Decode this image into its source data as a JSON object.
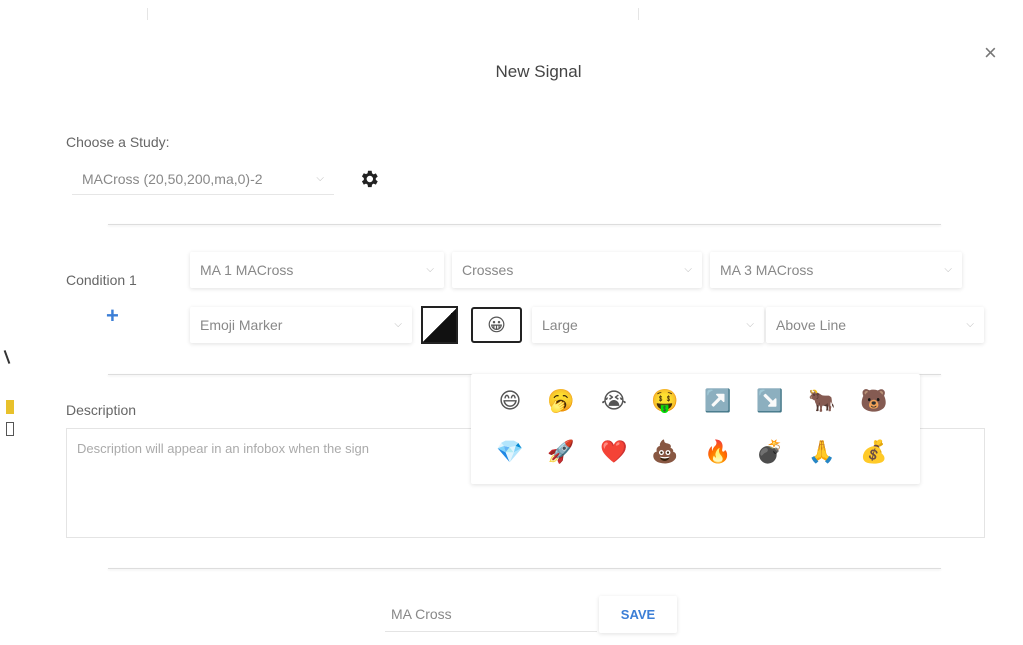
{
  "dialog": {
    "title": "New Signal",
    "close_glyph": "×"
  },
  "study": {
    "label": "Choose a Study:",
    "selected": "MACross (20,50,200,ma,0)-2",
    "chevron": "⌵",
    "settings_icon": "gear-icon"
  },
  "condition": {
    "label": "Condition 1",
    "add_icon": "+",
    "row1": {
      "field1": "MA 1 MACross",
      "operator": "Crosses",
      "field2": "MA 3 MACross"
    },
    "row2": {
      "marker_type": "Emoji Marker",
      "color_swatch": "black-white",
      "selected_emoji": "😀",
      "size": "Large",
      "position": "Above Line"
    }
  },
  "emoji_picker": {
    "row1": [
      "😄",
      "🥱",
      "😭",
      "🤑",
      "↗️",
      "↘️",
      "🐂",
      "🐻"
    ],
    "row2": [
      "💎",
      "🚀",
      "❤️",
      "💩",
      "🔥",
      "💣",
      "🙏",
      "💰"
    ]
  },
  "description": {
    "label": "Description",
    "placeholder": "Description will appear in an infobox when the sign"
  },
  "footer": {
    "name_value": "MA Cross",
    "save_label": "SAVE"
  },
  "colors": {
    "accent": "#3b7ed6",
    "text": "#666666"
  }
}
